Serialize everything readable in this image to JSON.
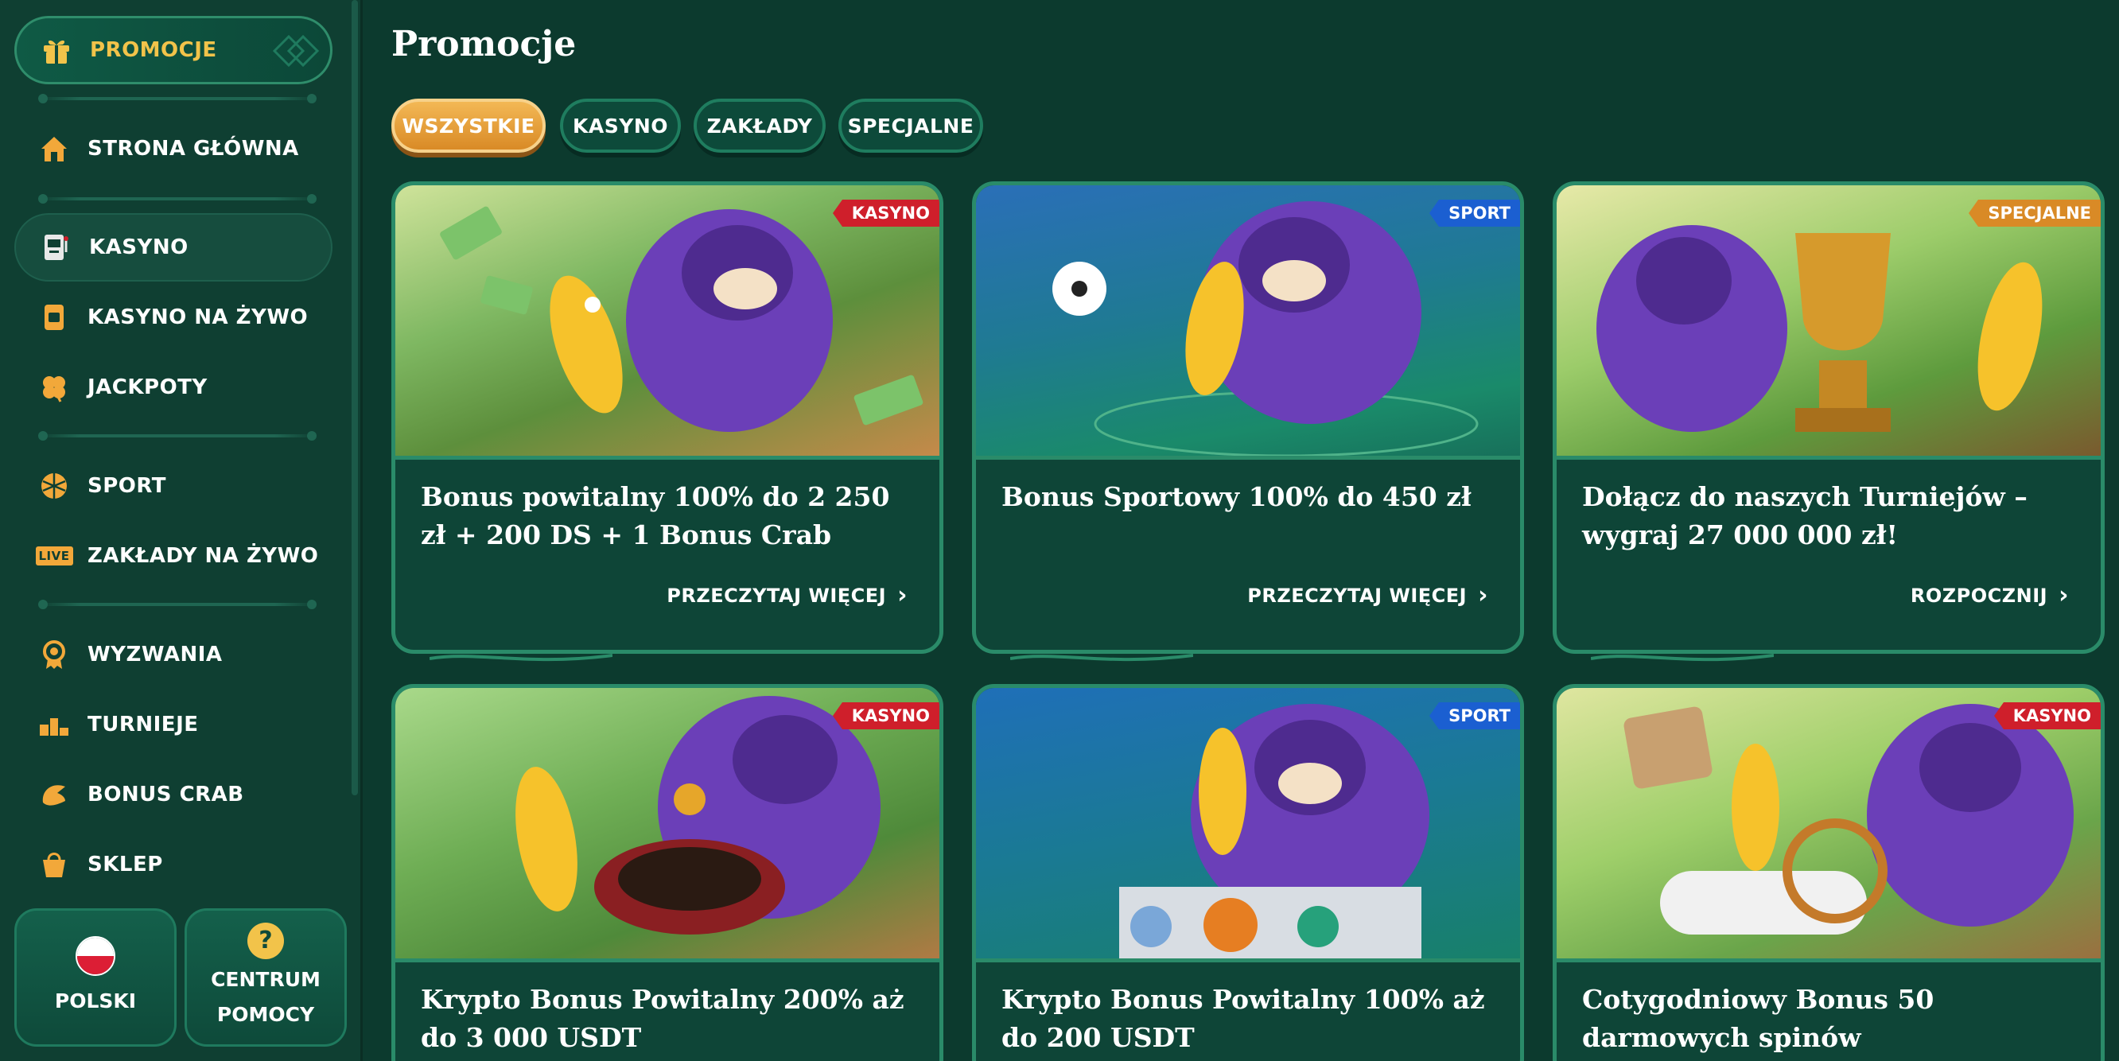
{
  "sidebar": {
    "promo_label": "PROMOCJE",
    "items": [
      {
        "label": "STRONA GŁÓWNA",
        "icon": "home-icon"
      },
      {
        "label": "KASYNO",
        "icon": "slot-machine-icon"
      },
      {
        "label": "KASYNO NA ŻYWO",
        "icon": "live-casino-icon"
      },
      {
        "label": "JACKPOTY",
        "icon": "clover-icon"
      },
      {
        "label": "SPORT",
        "icon": "ball-icon"
      },
      {
        "label": "ZAKŁADY NA ŻYWO",
        "icon": "live-badge-icon"
      },
      {
        "label": "WYZWANIA",
        "icon": "medal-icon"
      },
      {
        "label": "TURNIEJE",
        "icon": "podium-icon"
      },
      {
        "label": "BONUS CRAB",
        "icon": "crab-claw-icon"
      },
      {
        "label": "SKLEP",
        "icon": "shopping-bag-icon"
      }
    ],
    "live_icon_text": "LIVE",
    "language_label": "POLSKI",
    "help_line1": "CENTRUM",
    "help_line2": "POMOCY",
    "help_icon_text": "?"
  },
  "main": {
    "title": "Promocje",
    "tabs": [
      "WSZYSTKIE",
      "KASYNO",
      "ZAKŁADY",
      "SPECJALNE"
    ]
  },
  "cards": [
    {
      "badge": "KASYNO",
      "title": "Bonus powitalny 100% do 2 250 zł + 200 DS + 1 Bonus Crab",
      "cta": "PRZECZYTAJ WIĘCEJ"
    },
    {
      "badge": "SPORT",
      "title": "Bonus Sportowy 100% do 450 zł",
      "cta": "PRZECZYTAJ WIĘCEJ"
    },
    {
      "badge": "SPECJALNE",
      "title": "Dołącz do naszych Turniejów – wygraj 27 000 000 zł!",
      "cta": "ROZPOCZNIJ"
    },
    {
      "badge": "KASYNO",
      "title": "Krypto Bonus Powitalny 200% aż do 3 000 USDT",
      "cta": ""
    },
    {
      "badge": "SPORT",
      "title": "Krypto Bonus Powitalny 100% aż do 200 USDT",
      "cta": ""
    },
    {
      "badge": "KASYNO",
      "title": "Cotygodniowy Bonus 50 darmowych spinów",
      "cta": ""
    }
  ],
  "colors": {
    "background": "#0c3a2e",
    "sidebar": "#0f3f32",
    "accent_gold": "#f2c34a",
    "tab_active": "#e9a23d",
    "badge_kasyno": "#cf1f2b",
    "badge_sport": "#1b5fd1",
    "badge_specjalne": "#d98a26"
  }
}
